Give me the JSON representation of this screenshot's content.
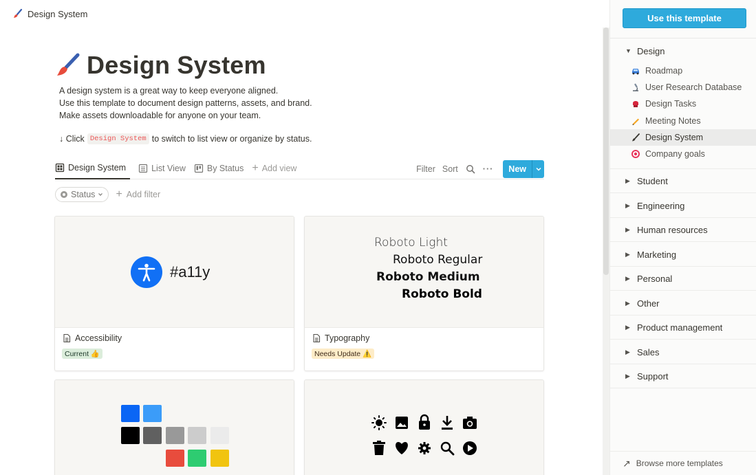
{
  "breadcrumb": {
    "label": "Design System"
  },
  "page": {
    "title": "Design System",
    "description": [
      "A design system is a great way to keep everyone aligned.",
      "Use this template to document design patterns, assets, and brand.",
      "Make assets downloadable for anyone on your team."
    ],
    "hint_prefix": "↓ Click",
    "hint_code": "Design System",
    "hint_suffix": "to switch to list view or organize by status."
  },
  "views": {
    "tabs": [
      "Design System",
      "List View",
      "By Status"
    ],
    "add_view": "Add view",
    "filter": "Filter",
    "sort": "Sort",
    "more": "···",
    "new": "New"
  },
  "filters": {
    "status_pill": "Status",
    "add_filter": "Add filter"
  },
  "cards": [
    {
      "title": "Accessibility",
      "tag": "Current 👍",
      "cover_text": "#a11y"
    },
    {
      "title": "Typography",
      "tag": "Needs Update ⚠️",
      "cover_lines": [
        "Roboto Light",
        "Roboto Regular",
        "Roboto Medium",
        "Roboto Bold"
      ]
    }
  ],
  "colors": {
    "accent": "#2eaadc",
    "palette": [
      "#0a66f5",
      "#3b9cf9",
      "#000000",
      "#606060",
      "#999999",
      "#cccccc",
      "#ebebeb",
      "#e84c3d",
      "#2ecc71",
      "#f1c40f"
    ]
  },
  "icons_card": [
    "brightness-icon",
    "image-icon",
    "lock-icon",
    "download-icon",
    "camera-icon",
    "trash-icon",
    "heart-icon",
    "settings-icon",
    "search-icon",
    "play-icon"
  ],
  "sidebar": {
    "use_template": "Use this template",
    "open_group": "Design",
    "items": [
      {
        "label": "Roadmap",
        "icon": "car-icon"
      },
      {
        "label": "User Research Database",
        "icon": "microscope-icon"
      },
      {
        "label": "Design Tasks",
        "icon": "boxing-glove-icon"
      },
      {
        "label": "Meeting Notes",
        "icon": "pencil-icon"
      },
      {
        "label": "Design System",
        "icon": "paintbrush-icon"
      },
      {
        "label": "Company goals",
        "icon": "target-icon"
      }
    ],
    "groups": [
      "Student",
      "Engineering",
      "Human resources",
      "Marketing",
      "Personal",
      "Other",
      "Product management",
      "Sales",
      "Support"
    ],
    "browse_more": "Browse more templates"
  }
}
